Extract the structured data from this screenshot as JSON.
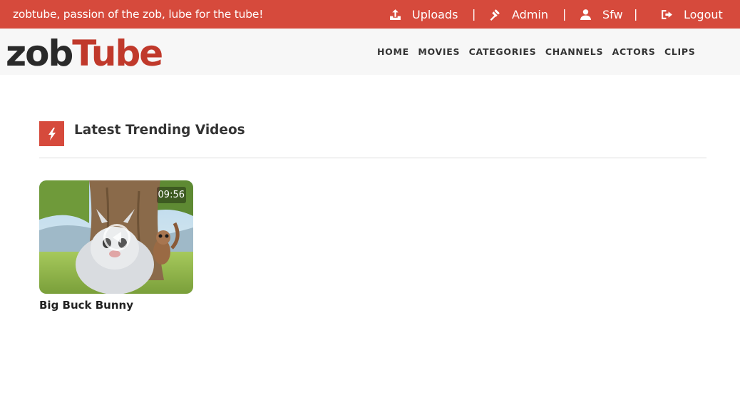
{
  "topbar": {
    "tagline": "zobtube, passion of the zob, lube for the tube!",
    "links": [
      {
        "label": "Uploads",
        "icon": "upload-icon"
      },
      {
        "label": "Admin",
        "icon": "gavel-icon"
      },
      {
        "label": "Sfw",
        "icon": "user-icon"
      },
      {
        "label": "Logout",
        "icon": "sign-out-icon"
      }
    ],
    "separator": "|"
  },
  "header": {
    "logo_part1": "zob",
    "logo_part2": "Tube",
    "nav": [
      "HOME",
      "MOVIES",
      "CATEGORIES",
      "CHANNELS",
      "ACTORS",
      "CLIPS"
    ]
  },
  "section": {
    "title": "Latest Trending Videos",
    "icon": "bolt-icon"
  },
  "videos": [
    {
      "title": "Big Buck Bunny",
      "duration": "09:56"
    }
  ],
  "colors": {
    "accent": "#d64a3c",
    "header_bg": "#f7f7f7"
  }
}
